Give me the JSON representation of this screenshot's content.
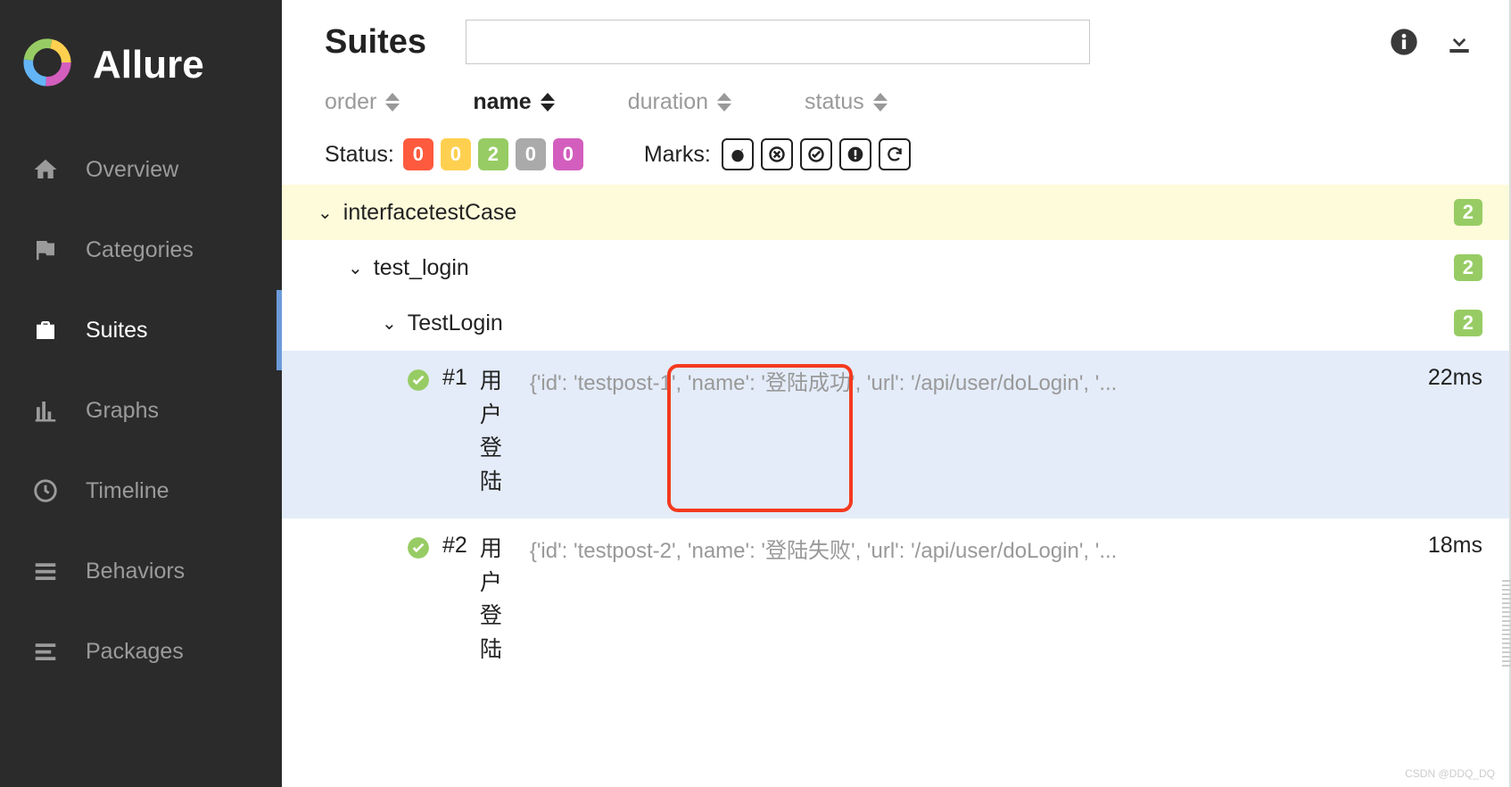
{
  "brand": "Allure",
  "sidebar": {
    "items": [
      {
        "label": "Overview",
        "icon": "home-icon"
      },
      {
        "label": "Categories",
        "icon": "flag-icon"
      },
      {
        "label": "Suites",
        "icon": "briefcase-icon"
      },
      {
        "label": "Graphs",
        "icon": "bar-chart-icon"
      },
      {
        "label": "Timeline",
        "icon": "clock-icon"
      },
      {
        "label": "Behaviors",
        "icon": "list-icon"
      },
      {
        "label": "Packages",
        "icon": "layers-icon"
      }
    ]
  },
  "header": {
    "title": "Suites"
  },
  "sort": {
    "order": "order",
    "name": "name",
    "duration": "duration",
    "status": "status",
    "active": "name"
  },
  "status_filter": {
    "label": "Status:",
    "badges": [
      {
        "value": "0",
        "color": "b-red"
      },
      {
        "value": "0",
        "color": "b-yellow"
      },
      {
        "value": "2",
        "color": "b-green"
      },
      {
        "value": "0",
        "color": "b-gray"
      },
      {
        "value": "0",
        "color": "b-pink"
      }
    ],
    "marks_label": "Marks:"
  },
  "tree": {
    "suite": {
      "label": "interfacetestCase",
      "count": "2"
    },
    "file": {
      "label": "test_login",
      "count": "2"
    },
    "class": {
      "label": "TestLogin",
      "count": "2"
    },
    "tests": [
      {
        "num": "#1",
        "name": "用户登陆",
        "params": "{'id': 'testpost-1', 'name': '登陆成功', 'url': '/api/user/doLogin', '...",
        "duration": "22ms",
        "selected": true
      },
      {
        "num": "#2",
        "name": "用户登陆",
        "params": "{'id': 'testpost-2', 'name': '登陆失败', 'url': '/api/user/doLogin', '...",
        "duration": "18ms",
        "selected": false
      }
    ]
  },
  "watermark": "CSDN @DDQ_DQ"
}
